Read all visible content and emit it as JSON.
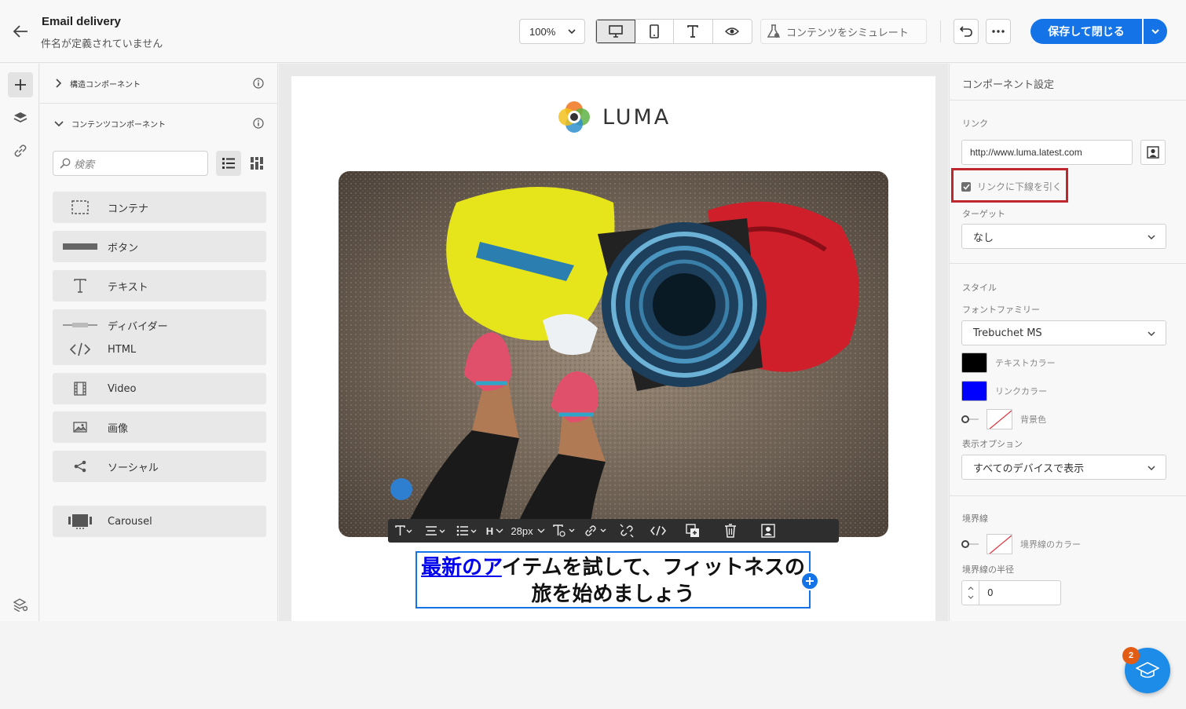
{
  "header": {
    "title": "Email delivery",
    "subtitle": "件名が定義されていません",
    "zoom": "100%",
    "simulate_label": "コンテンツをシミュレート",
    "save_label": "保存して閉じる"
  },
  "components_panel": {
    "structure_label": "構造コンポーネント",
    "content_label": "コンテンツコンポーネント",
    "search_placeholder": "検索",
    "items": [
      {
        "label": "コンテナ",
        "icon": "container-icon"
      },
      {
        "label": "ボタン",
        "icon": "button-icon"
      },
      {
        "label": "テキスト",
        "icon": "text-icon"
      },
      {
        "label": "ディバイダー",
        "icon": "divider-icon"
      },
      {
        "label": "HTML",
        "icon": "code-icon"
      },
      {
        "label": "Video",
        "icon": "video-icon"
      },
      {
        "label": "画像",
        "icon": "image-icon"
      },
      {
        "label": "ソーシャル",
        "icon": "share-icon"
      },
      {
        "label": "Carousel",
        "icon": "carousel-icon"
      }
    ]
  },
  "email": {
    "logo_text": "LUMA",
    "toolbar": {
      "heading": "H",
      "font_size": "28px"
    },
    "headline_link": "最新のア",
    "headline_rest": "イテムを試して、フィットネスの旅を始めましょう"
  },
  "settings_panel": {
    "title": "コンポーネント設定",
    "link_label": "リンク",
    "link_value": "http://www.luma.latest.com",
    "underline_label": "リンクに下線を引く",
    "underline_checked": true,
    "target_label": "ターゲット",
    "target_value": "なし",
    "style_label": "スタイル",
    "font_family_label": "フォントファミリー",
    "font_family_value": "Trebuchet MS",
    "text_color_label": "テキストカラー",
    "text_color": "#000000",
    "link_color_label": "リンクカラー",
    "link_color": "#0000ff",
    "bg_color_label": "背景色",
    "display_label": "表示オプション",
    "display_value": "すべてのデバイスで表示",
    "border_label": "境界線",
    "border_color_label": "境界線のカラー",
    "border_radius_label": "境界線の半径",
    "border_radius_value": "0"
  },
  "learn": {
    "badge": "2"
  },
  "colors": {
    "accent": "#1473e6",
    "highlight": "#c0262d"
  }
}
